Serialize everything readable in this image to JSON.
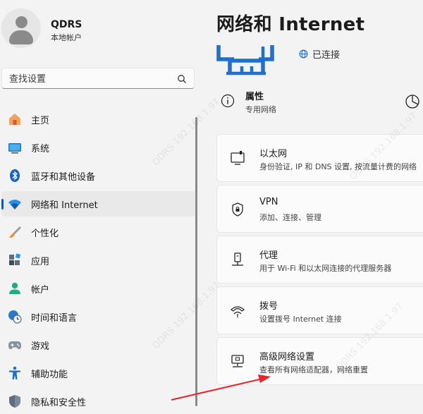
{
  "user": {
    "name": "QDRS",
    "account_type": "本地帐户"
  },
  "search": {
    "placeholder": "查找设置"
  },
  "sidebar": {
    "items": [
      {
        "label": "主页",
        "icon": "home-icon"
      },
      {
        "label": "系统",
        "icon": "system-monitor-icon"
      },
      {
        "label": "蓝牙和其他设备",
        "icon": "bluetooth-icon"
      },
      {
        "label": "网络和 Internet",
        "icon": "wifi-icon",
        "active": true
      },
      {
        "label": "个性化",
        "icon": "paintbrush-icon"
      },
      {
        "label": "应用",
        "icon": "apps-icon"
      },
      {
        "label": "帐户",
        "icon": "account-icon"
      },
      {
        "label": "时间和语言",
        "icon": "globe-clock-icon"
      },
      {
        "label": "游戏",
        "icon": "gamepad-icon"
      },
      {
        "label": "辅助功能",
        "icon": "accessibility-icon"
      },
      {
        "label": "隐私和安全性",
        "icon": "shield-icon"
      }
    ]
  },
  "main": {
    "title": "网络和 Internet",
    "status": "已连接",
    "properties": {
      "title": "属性",
      "subtitle": "专用网络"
    },
    "cards": [
      {
        "title": "以太网",
        "subtitle": "身份验证, IP 和 DNS 设置, 按流量计费的网络",
        "icon": "ethernet-icon"
      },
      {
        "title": "VPN",
        "subtitle": "添加、连接、管理",
        "icon": "vpn-shield-icon"
      },
      {
        "title": "代理",
        "subtitle": "用于 Wi-Fi 和以太网连接的代理服务器",
        "icon": "proxy-icon"
      },
      {
        "title": "拨号",
        "subtitle": "设置拨号 Internet 连接",
        "icon": "dialup-icon"
      },
      {
        "title": "高级网络设置",
        "subtitle": "查看所有网络适配器，网络重置",
        "icon": "advanced-network-icon"
      }
    ]
  },
  "colors": {
    "accent": "#005fb8",
    "annotation_arrow": "#e8242c",
    "hero_icon": "#1f6fd1"
  }
}
